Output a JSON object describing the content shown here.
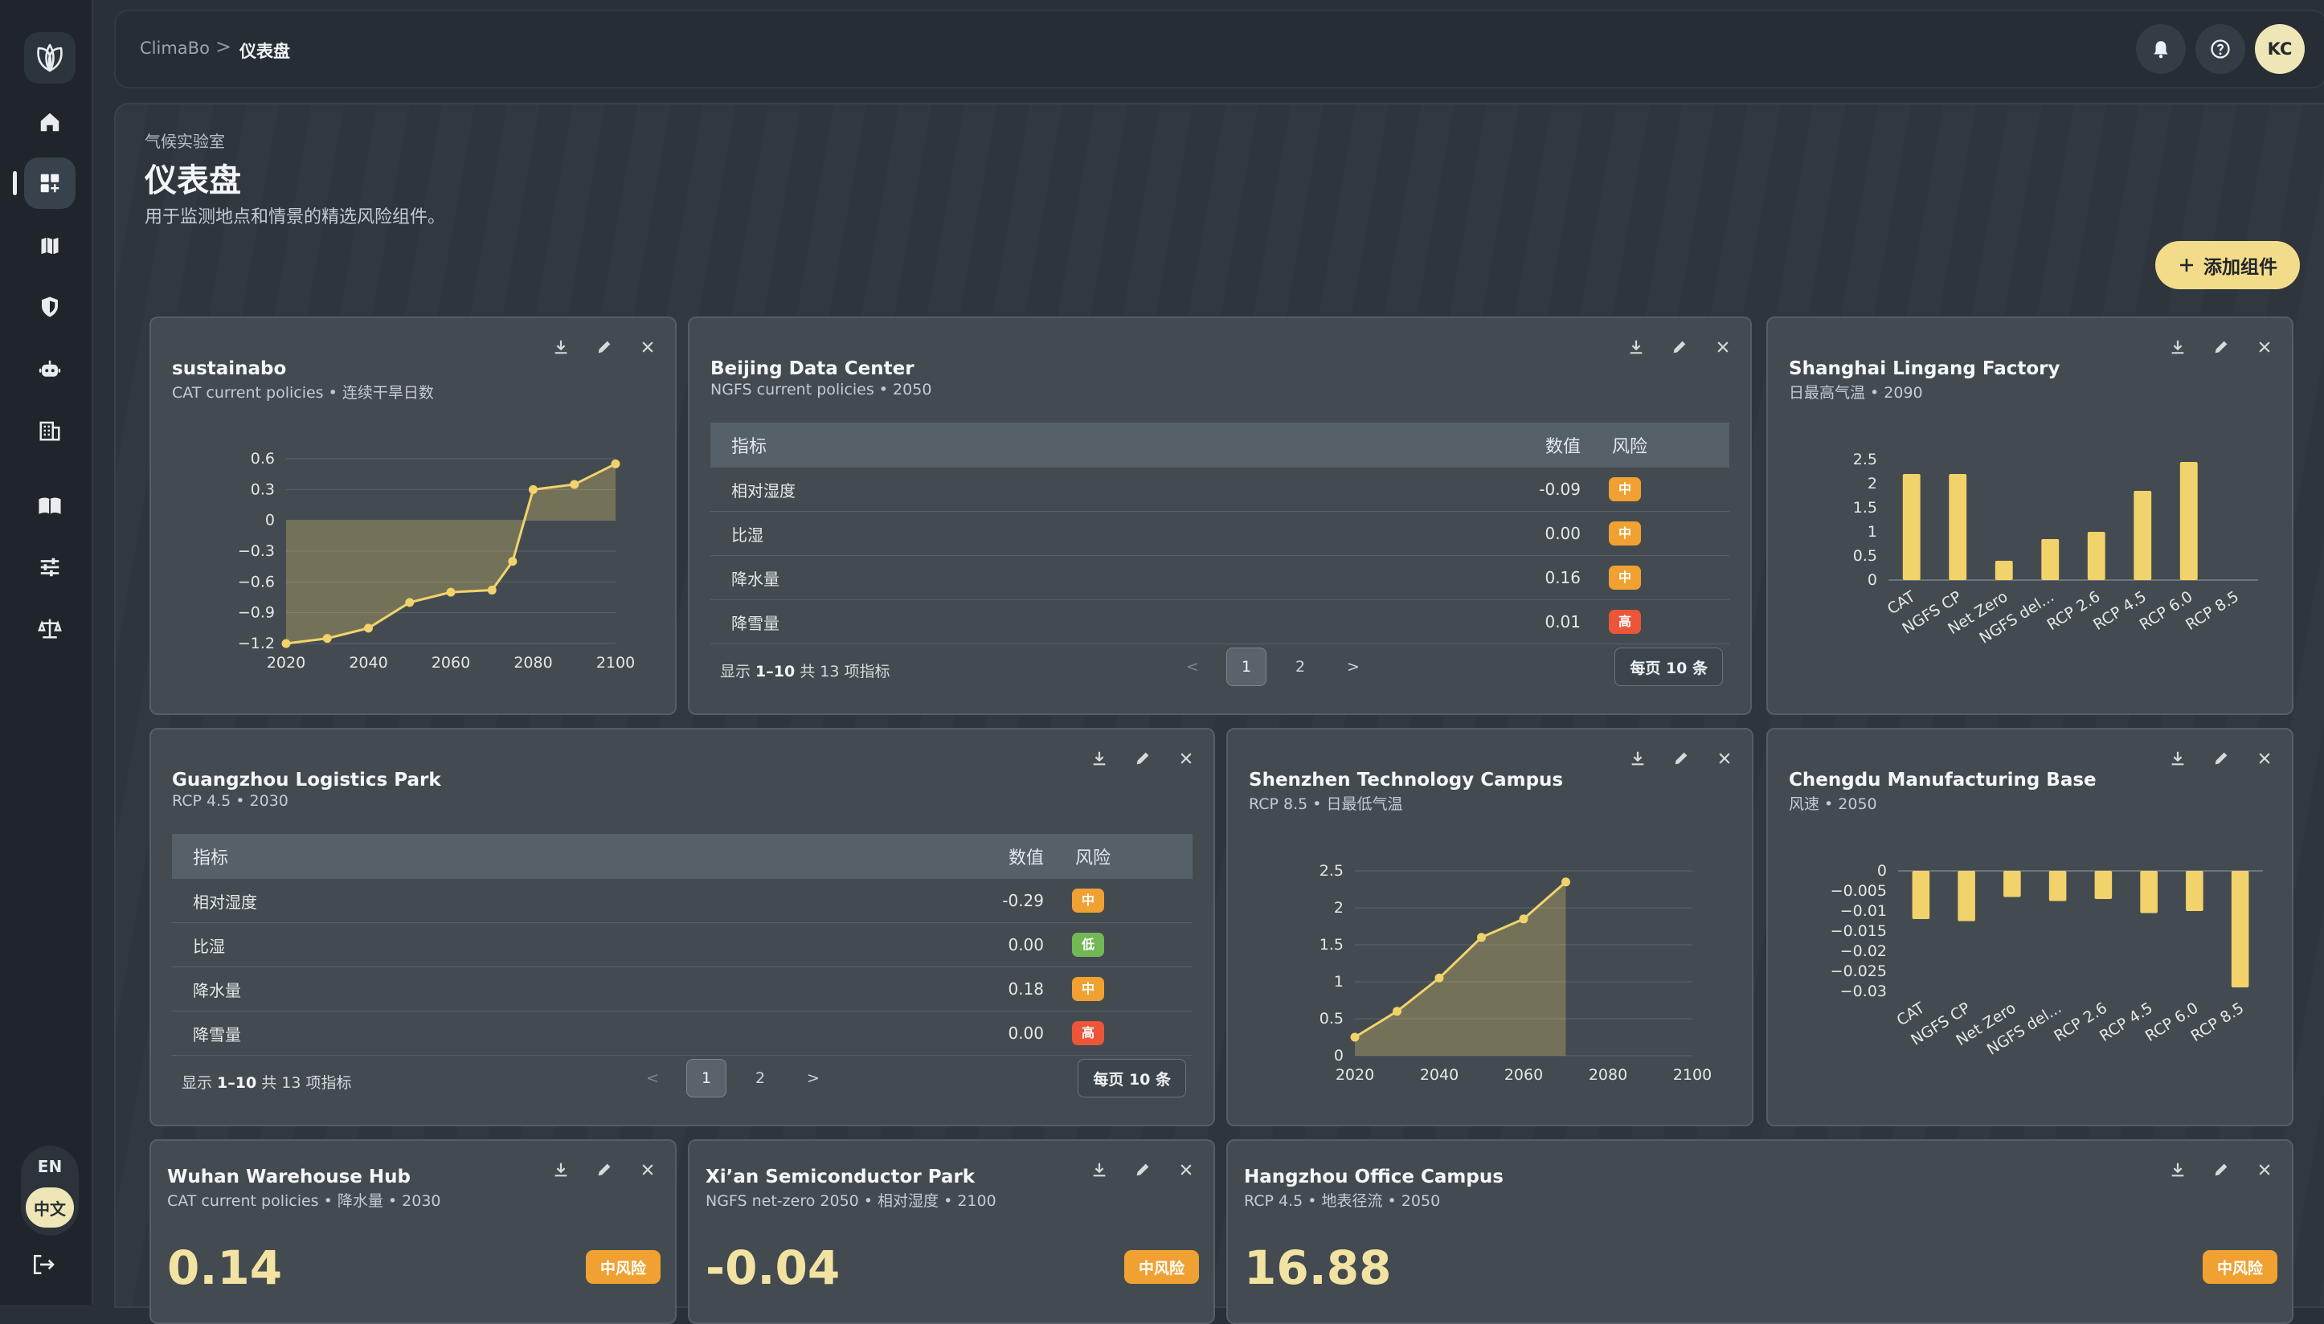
{
  "app": {
    "brand": "ClimaBo",
    "accent": "#f2dc8a",
    "logo_icon": "leaf-logo-icon"
  },
  "breadcrumb": {
    "root": "ClimaBo",
    "separator": ">",
    "current": "仪表盘"
  },
  "header": {
    "avatar_initials": "KC",
    "notification_icon": "bell-icon",
    "help_icon": "help-icon"
  },
  "sidebar": {
    "items": [
      {
        "icon": "home-icon"
      },
      {
        "icon": "dashboard-icon",
        "active": true
      },
      {
        "icon": "map-icon"
      },
      {
        "icon": "shield-icon"
      },
      {
        "icon": "robot-icon"
      },
      {
        "icon": "building-icon"
      },
      {
        "icon": "book-icon"
      },
      {
        "icon": "sliders-icon"
      },
      {
        "icon": "scale-icon"
      }
    ],
    "lang_en": "EN",
    "lang_zh": "中文",
    "logout_icon": "logout-icon"
  },
  "page": {
    "eyebrow": "气候实验室",
    "title": "仪表盘",
    "subtitle": "用于监测地点和情景的精选风险组件。",
    "add_button": "添加组件"
  },
  "widgets": {
    "sustainabo": {
      "title": "sustainabo",
      "subtitle": "CAT current policies • 连续干旱日数"
    },
    "beijing": {
      "title": "Beijing Data Center",
      "subtitle": "NGFS current policies • 2050",
      "headers": {
        "metric": "指标",
        "value": "数值",
        "risk": "风险"
      },
      "rows": [
        {
          "metric": "相对湿度",
          "value": "-0.09",
          "risk": "中",
          "level": "mid"
        },
        {
          "metric": "比湿",
          "value": "0.00",
          "risk": "中",
          "level": "mid"
        },
        {
          "metric": "降水量",
          "value": "0.16",
          "risk": "中",
          "level": "mid"
        },
        {
          "metric": "降雪量",
          "value": "0.01",
          "risk": "高",
          "level": "high"
        }
      ],
      "footer_prefix": "显示 ",
      "footer_range": "1–10",
      "footer_suffix": " 共 13 项指标",
      "pages": [
        "1",
        "2"
      ],
      "prev": "<",
      "next": ">",
      "per_page": "每页 10 条"
    },
    "shanghai": {
      "title": "Shanghai Lingang Factory",
      "subtitle": "日最高气温 • 2090"
    },
    "guangzhou": {
      "title": "Guangzhou Logistics Park",
      "subtitle": "RCP 4.5 • 2030",
      "headers": {
        "metric": "指标",
        "value": "数值",
        "risk": "风险"
      },
      "rows": [
        {
          "metric": "相对湿度",
          "value": "-0.29",
          "risk": "中",
          "level": "mid"
        },
        {
          "metric": "比湿",
          "value": "0.00",
          "risk": "低",
          "level": "low"
        },
        {
          "metric": "降水量",
          "value": "0.18",
          "risk": "中",
          "level": "mid"
        },
        {
          "metric": "降雪量",
          "value": "0.00",
          "risk": "高",
          "level": "high"
        }
      ],
      "footer_prefix": "显示 ",
      "footer_range": "1–10",
      "footer_suffix": " 共 13 项指标",
      "pages": [
        "1",
        "2"
      ],
      "prev": "<",
      "next": ">",
      "per_page": "每页 10 条"
    },
    "shenzhen": {
      "title": "Shenzhen Technology Campus",
      "subtitle": "RCP 8.5 • 日最低气温"
    },
    "chengdu": {
      "title": "Chengdu Manufacturing Base",
      "subtitle": "风速 • 2050"
    },
    "wuhan": {
      "title": "Wuhan Warehouse Hub",
      "subtitle": "CAT current policies • 降水量 • 2030",
      "value": "0.14",
      "badge": "中风险"
    },
    "xian": {
      "title": "Xi’an Semiconductor Park",
      "subtitle": "NGFS net-zero 2050 • 相对湿度 • 2100",
      "value": "-0.04",
      "badge": "中风险"
    },
    "hangzhou": {
      "title": "Hangzhou Office Campus",
      "subtitle": "RCP 4.5 • 地表径流 • 2050",
      "value": "16.88",
      "badge": "中风险"
    }
  },
  "chart_data": [
    {
      "type": "area",
      "x": [
        2020,
        2030,
        2040,
        2050,
        2060,
        2070,
        2075,
        2080,
        2090,
        2100
      ],
      "y": [
        -1.2,
        -1.15,
        -1.05,
        -0.8,
        -0.7,
        -0.68,
        -0.4,
        0.3,
        0.35,
        0.55
      ],
      "xticks": [
        "2020",
        "2040",
        "2060",
        "2080",
        "2100"
      ],
      "yticks": [
        "0.6",
        "0.3",
        "0",
        "−0.3",
        "−0.6",
        "−0.9",
        "−1.2"
      ],
      "ylim": [
        -1.2,
        0.6
      ],
      "xlim": [
        2020,
        2100
      ],
      "color": "#f2d36b"
    },
    {
      "type": "bar",
      "categories": [
        "CAT",
        "NGFS CP",
        "Net Zero",
        "NGFS del...",
        "RCP 2.6",
        "RCP 4.5",
        "RCP 6.0",
        "RCP 8.5"
      ],
      "values": [
        2.2,
        2.2,
        0.4,
        0.85,
        1.0,
        1.85,
        2.45,
        0
      ],
      "yticks": [
        "2.5",
        "2",
        "1.5",
        "1",
        "0.5",
        "0"
      ],
      "ylim": [
        0,
        2.5
      ],
      "color": "#f2d36b"
    },
    {
      "type": "area",
      "x": [
        2020,
        2030,
        2040,
        2050,
        2060,
        2070
      ],
      "y": [
        0.25,
        0.6,
        1.05,
        1.6,
        1.85,
        2.35
      ],
      "xticks": [
        "2020",
        "2040",
        "2060",
        "2080",
        "2100"
      ],
      "yticks": [
        "2.5",
        "2",
        "1.5",
        "1",
        "0.5",
        "0"
      ],
      "ylim": [
        0,
        2.5
      ],
      "xlim": [
        2020,
        2100
      ],
      "color": "#f2d36b"
    },
    {
      "type": "bar",
      "categories": [
        "CAT",
        "NGFS CP",
        "Net Zero",
        "NGFS del...",
        "RCP 2.6",
        "RCP 4.5",
        "RCP 6.0",
        "RCP 8.5"
      ],
      "values": [
        -0.012,
        -0.0125,
        -0.0065,
        -0.0075,
        -0.007,
        -0.0105,
        -0.01,
        -0.029
      ],
      "yticks": [
        "0",
        "−0.005",
        "−0.01",
        "−0.015",
        "−0.02",
        "−0.025",
        "−0.03"
      ],
      "ylim": [
        -0.03,
        0
      ],
      "color": "#f2d36b"
    }
  ]
}
